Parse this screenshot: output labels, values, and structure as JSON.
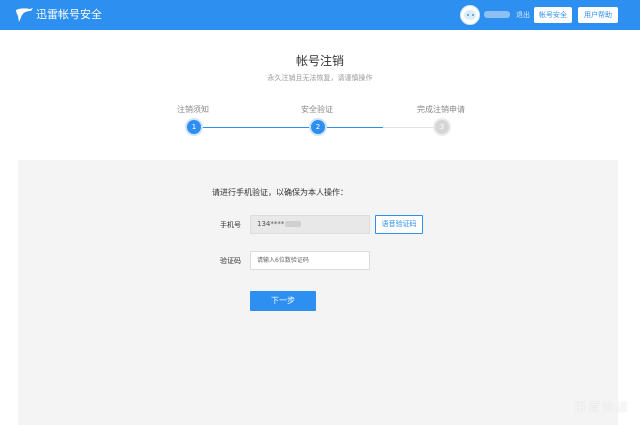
{
  "header": {
    "brand": "迅雷帐号安全",
    "logout": "退出",
    "account_security": "帐号安全",
    "help": "用户帮助"
  },
  "page": {
    "title": "帐号注销",
    "subtitle": "永久注销且无法恢复，请谨慎操作"
  },
  "steps": [
    {
      "label": "注销须知",
      "number": "1",
      "state": "done"
    },
    {
      "label": "安全验证",
      "number": "2",
      "state": "current"
    },
    {
      "label": "完成注销申请",
      "number": "3",
      "state": "pending"
    }
  ],
  "form": {
    "instruction": "请进行手机验证，以确保为本人操作：",
    "phone_label": "手机号",
    "phone_value": "134****",
    "voice_code_button": "语音验证码",
    "code_label": "验证码",
    "code_placeholder": "请输入6位数验证码",
    "next_button": "下一步"
  },
  "watermark": "百度知道",
  "colors": {
    "primary": "#2d8ff0",
    "panel_bg": "#f4f4f4"
  }
}
